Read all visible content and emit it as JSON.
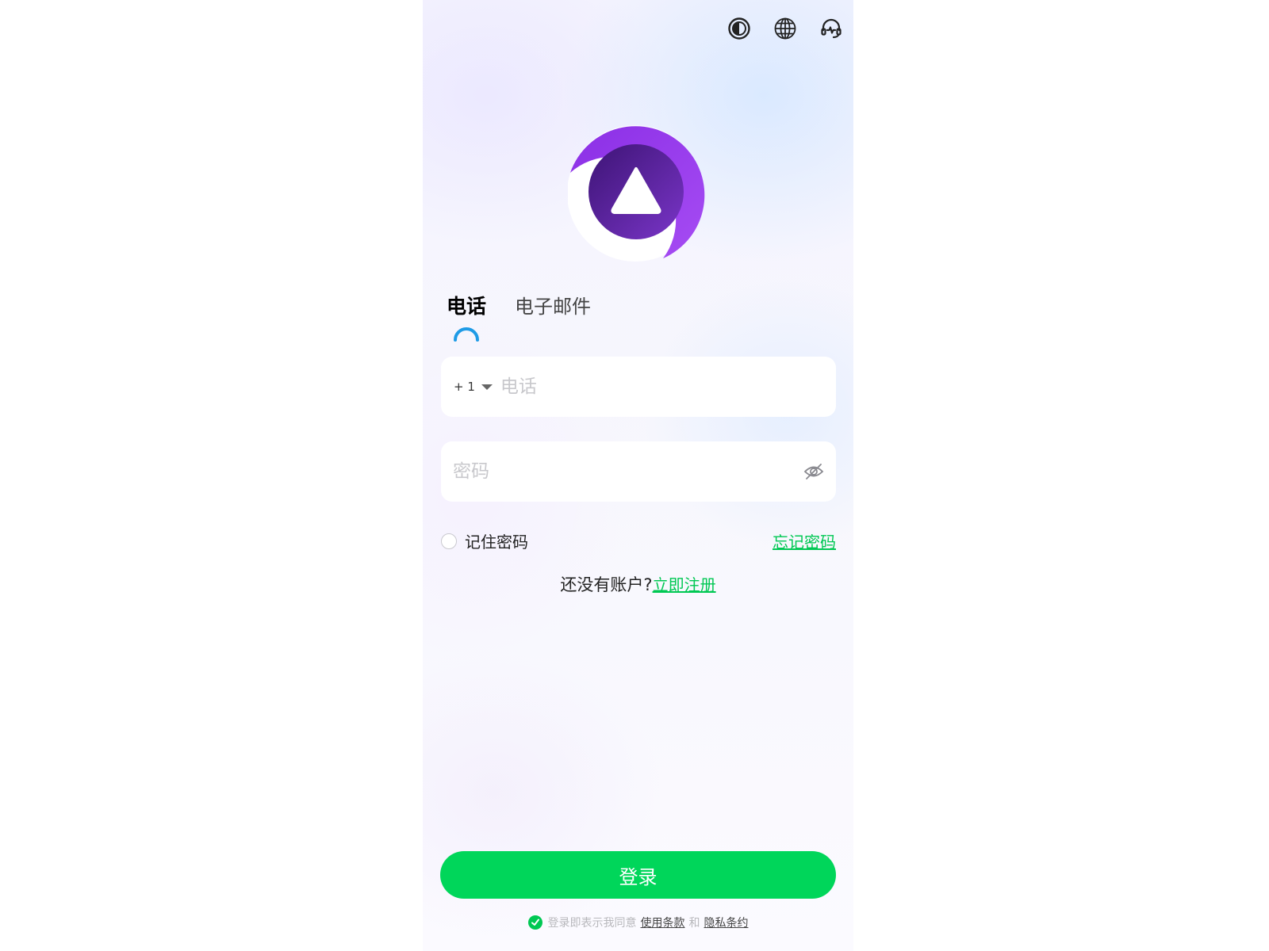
{
  "header": {
    "icons": [
      "contrast-icon",
      "globe-icon",
      "support-headset-icon"
    ]
  },
  "logo": {
    "name": "triangle-play-logo",
    "colors": {
      "ring": "#9b42f0",
      "inner": "#5a1fa0",
      "triangle": "#ffffff"
    }
  },
  "tabs": [
    {
      "label": "电话",
      "active": true
    },
    {
      "label": "电子邮件",
      "active": false
    }
  ],
  "phone_field": {
    "country_code": "+ 1",
    "placeholder": "电话",
    "value": ""
  },
  "password_field": {
    "placeholder": "密码",
    "value": ""
  },
  "remember": {
    "label": "记住密码",
    "checked": false
  },
  "forgot_link": "忘记密码",
  "signup": {
    "prompt": "还没有账户?",
    "link": "立即注册"
  },
  "login_button": "登录",
  "agreement": {
    "checked": true,
    "prefix": "登录即表示我同意",
    "terms": "使用条款",
    "and": "和",
    "privacy": "隐私条约"
  },
  "colors": {
    "accent_green": "#00d65a",
    "link_green": "#00c853",
    "tab_indicator": "#1e9be6"
  }
}
